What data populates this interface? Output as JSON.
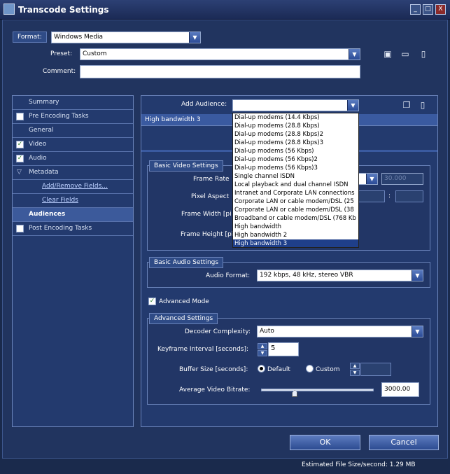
{
  "window": {
    "title": "Transcode Settings",
    "minimize": "_",
    "maximize": "□",
    "close": "X"
  },
  "format": {
    "tab_label": "Format:",
    "value": "Windows Media"
  },
  "preset": {
    "label": "Preset:",
    "value": "Custom"
  },
  "comment": {
    "label": "Comment:",
    "value": ""
  },
  "nav": {
    "items": [
      {
        "label": "Summary",
        "checked": null
      },
      {
        "label": "Pre Encoding Tasks",
        "checked": false
      },
      {
        "label": "General",
        "checked": null
      },
      {
        "label": "Video",
        "checked": true
      },
      {
        "label": "Audio",
        "checked": true
      },
      {
        "label": "Metadata",
        "checked": null
      },
      {
        "label": "Add/Remove Fields...",
        "checked": null
      },
      {
        "label": "Clear Fields",
        "checked": null
      },
      {
        "label": "Audiences",
        "checked": null
      },
      {
        "label": "Post Encoding Tasks",
        "checked": false
      }
    ]
  },
  "audience": {
    "label": "Add Audience:",
    "value": "",
    "list_row": "High bandwidth 3",
    "options": [
      "Dial-up modems (14.4 Kbps)",
      "Dial-up modems (28.8 Kbps)",
      "Dial-up modems (28.8 Kbps)2",
      "Dial-up modems (28.8 Kbps)3",
      "Dial-up modems (56 Kbps)",
      "Dial-up modems (56 Kbps)2",
      "Dial-up modems (56 Kbps)3",
      "Single channel ISDN",
      "Local playback and dual channel ISDN",
      "Intranet and Corporate LAN connections",
      "Corporate LAN or cable modem/DSL (25",
      "Corporate LAN or cable modem/DSL (38",
      "Broadband or cable modem/DSL (768 Kb",
      "High bandwidth",
      "High bandwidth 2",
      "High bandwidth 3"
    ],
    "selected_index": 15
  },
  "video": {
    "group_title": "Basic Video Settings",
    "frame_rate_label": "Frame Rate",
    "frame_rate_value": "30.000",
    "pixel_aspect_label": "Pixel Aspect",
    "pixel_aspect_sep": ":",
    "frame_width_label": "Frame Width [pi",
    "frame_height_label": "Frame Height [pi"
  },
  "audio": {
    "group_title": "Basic Audio Settings",
    "format_label": "Audio Format:",
    "format_value": "192 kbps, 48 kHz, stereo VBR"
  },
  "advanced_mode": {
    "label": "Advanced Mode",
    "checked": true
  },
  "advanced": {
    "group_title": "Advanced Settings",
    "decoder_label": "Decoder Complexity:",
    "decoder_value": "Auto",
    "keyframe_label": "Keyframe Interval [seconds]:",
    "keyframe_value": "5",
    "buffer_label": "Buffer Size [seconds]:",
    "buffer_default": "Default",
    "buffer_custom": "Custom",
    "buffer_selected": "Default",
    "bitrate_label": "Average Video Bitrate:",
    "bitrate_value": "3000.00",
    "bitrate_slider_fraction": 0.3
  },
  "buttons": {
    "ok": "OK",
    "cancel": "Cancel"
  },
  "status": {
    "text": "Estimated File Size/second: 1.29 MB"
  },
  "icons": {
    "save": "save-icon",
    "open": "folder-open-icon",
    "delete": "trash-icon",
    "copy": "copy-icon"
  }
}
